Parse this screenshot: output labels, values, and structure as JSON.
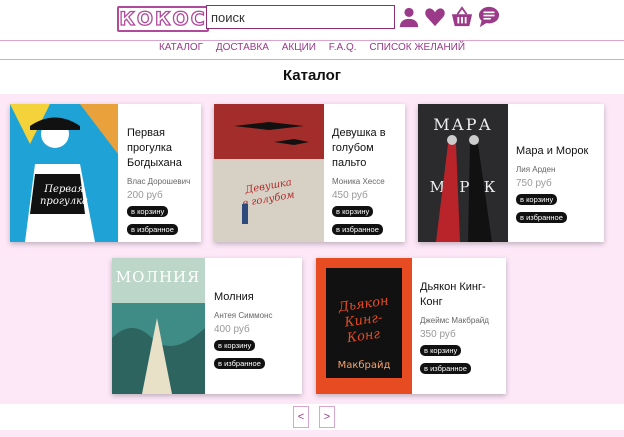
{
  "header": {
    "logo": "КОКОС",
    "search_placeholder": "поиск",
    "icons": [
      "user-icon",
      "heart-icon",
      "basket-icon",
      "chat-icon"
    ]
  },
  "nav": {
    "items": [
      "КАТАЛОГ",
      "ДОСТАВКА",
      "АКЦИИ",
      "F.A.Q.",
      "СПИСОК ЖЕЛАНИЙ"
    ]
  },
  "page": {
    "title": "Каталог"
  },
  "books": [
    {
      "title": "Первая прогулка Богдыхана",
      "author": "Влас Дорошевич",
      "price": "200 руб",
      "cart": "в корзину",
      "fav": "в избранное",
      "cover_title": "Первая прогулка богдыхана",
      "cover_bg": "#1fa3d6"
    },
    {
      "title": "Девушка в голубом пальто",
      "author": "Моника Хессе",
      "price": "450 руб",
      "cart": "в корзину",
      "fav": "в избранное",
      "cover_title": "Девушка в голубом пальто",
      "cover_bg": "#c4473a"
    },
    {
      "title": "Мара и Морок",
      "author": "Лия Арден",
      "price": "750 руб",
      "cart": "в корзину",
      "fav": "в избранное",
      "cover_title": "МАРА И МОРОК",
      "cover_bg": "#2b2b2e"
    },
    {
      "title": "Молния",
      "author": "Антея Симмонс",
      "price": "400 руб",
      "cart": "в корзину",
      "fav": "в избранное",
      "cover_title": "МОЛНИЯ",
      "cover_bg": "#3f8c86"
    },
    {
      "title": "Дьякон Кинг-Конг",
      "author": "Джеймс Макбрайд",
      "price": "350 руб",
      "cart": "в корзину",
      "fav": "в избранное",
      "cover_title": "Дьякон Кинг-Конг",
      "cover_bg": "#e64b22"
    }
  ],
  "pager": {
    "prev": "<",
    "next": ">"
  },
  "colors": {
    "accent": "#9a3a89",
    "catalog_bg": "#fde8f8"
  }
}
